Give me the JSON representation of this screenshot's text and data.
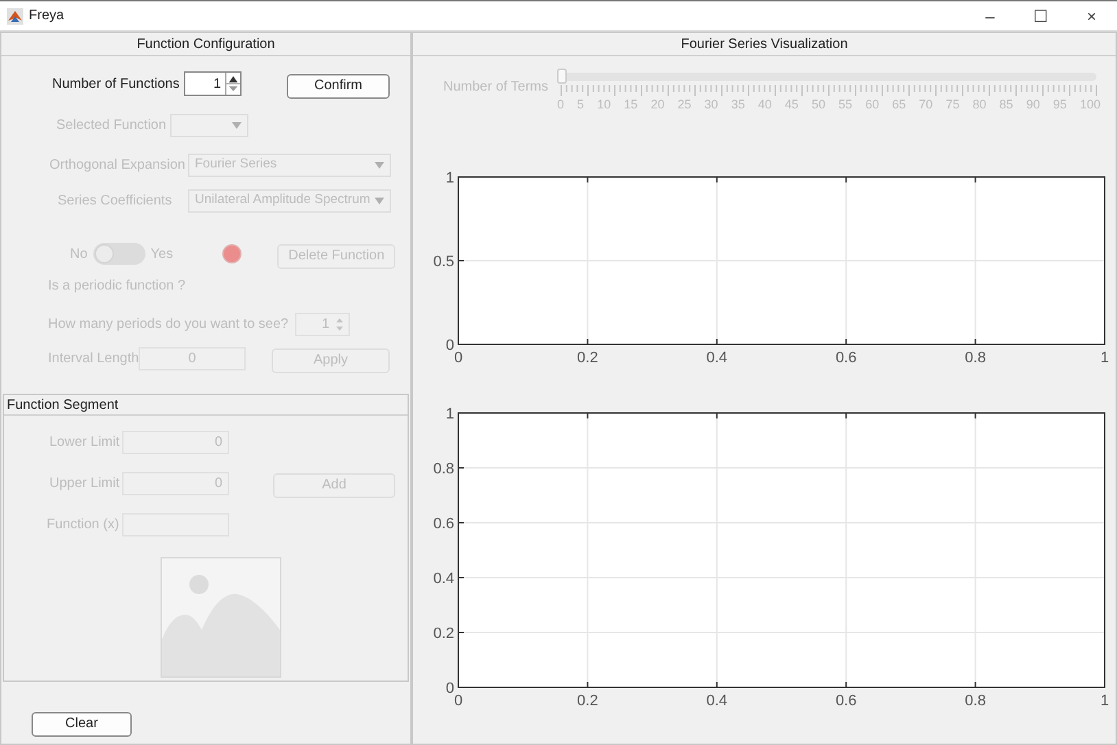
{
  "window": {
    "title": "Freya",
    "controls": [
      "–",
      "☐",
      "×"
    ]
  },
  "config_panel": {
    "title": "Function Configuration",
    "number_of_functions": {
      "label": "Number of Functions",
      "value": "1",
      "disabled": false
    },
    "confirm_button": {
      "label": "Confirm",
      "disabled": false
    },
    "selected_function": {
      "label": "Selected Function",
      "disabled": true
    },
    "orthogonal_expansion": {
      "label": "Orthogonal Expansion",
      "value": "Fourier Series",
      "disabled": true
    },
    "series_coefficients": {
      "label": "Series Coefficients",
      "value": "Unilateral Amplitude Spectrum",
      "disabled": true
    },
    "periodic_switch": {
      "off_label": "No",
      "on_label": "Yes",
      "on": false,
      "disabled": true
    },
    "delete_button": {
      "label": "Delete Function",
      "disabled": true
    },
    "periodic_question": {
      "text": "Is a periodic function ?",
      "disabled": true
    },
    "periods": {
      "label": "How many periods do you want to see?",
      "value": "1",
      "disabled": true
    },
    "interval_length": {
      "label": "Interval Length",
      "value": "0",
      "disabled": true
    },
    "apply_button": {
      "label": "Apply",
      "disabled": true
    }
  },
  "segment_panel": {
    "title": "Function Segment",
    "lower_limit": {
      "label": "Lower Limit",
      "value": "0",
      "disabled": true
    },
    "upper_limit": {
      "label": "Upper Limit",
      "value": "0",
      "disabled": true
    },
    "add_button": {
      "label": "Add",
      "disabled": true
    },
    "function_field": {
      "label": "Function (x)",
      "disabled": true
    }
  },
  "clear_button": {
    "label": "Clear",
    "disabled": false
  },
  "visualization_panel": {
    "title": "Fourier Series Visualization",
    "terms_slider": {
      "label": "Number of Terms",
      "level": 0,
      "disabled": true,
      "tick_labels": [
        "0",
        "5",
        "10",
        "15",
        "20",
        "25",
        "30",
        "35",
        "40",
        "45",
        "50",
        "55",
        "60",
        "65",
        "70",
        "75",
        "80",
        "85",
        "90",
        "95",
        "100"
      ]
    },
    "charts": [
      {
        "chart_data": {
          "type": "line",
          "xlim": [
            0,
            1
          ],
          "ylim": [
            0,
            1
          ],
          "xticks": [
            0,
            0.2,
            0.4,
            0.6,
            0.8,
            1
          ],
          "yticks": [
            0,
            0.5,
            1
          ],
          "grid": true
        }
      },
      {
        "chart_data": {
          "type": "line",
          "xlim": [
            0,
            1
          ],
          "ylim": [
            0,
            1
          ],
          "xticks": [
            0,
            0.2,
            0.4,
            0.6,
            0.8,
            1
          ],
          "yticks": [
            0,
            0.2,
            0.4,
            0.6,
            0.8,
            1
          ],
          "grid": true
        }
      }
    ]
  }
}
